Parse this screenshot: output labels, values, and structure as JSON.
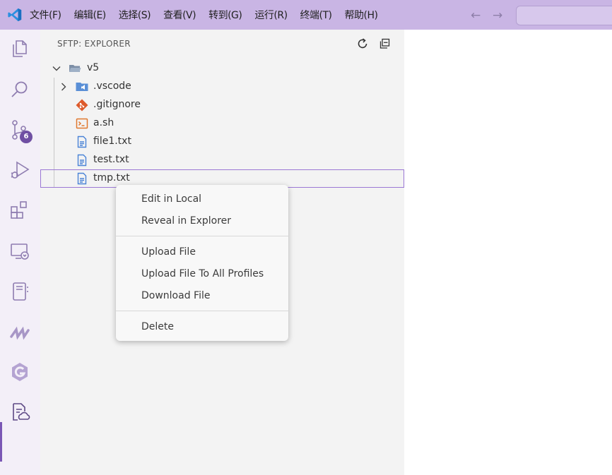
{
  "titlebar": {
    "menus": [
      "文件(F)",
      "编辑(E)",
      "选择(S)",
      "查看(V)",
      "转到(G)",
      "运行(R)",
      "终端(T)",
      "帮助(H)"
    ],
    "back_arrow": "←",
    "forward_arrow": "→"
  },
  "activity_bar": {
    "source_control_badge": "6"
  },
  "sidebar": {
    "title": "SFTP: EXPLORER",
    "root_folder": "v5",
    "items": [
      {
        "label": ".vscode",
        "icon": "vscode-folder-icon"
      },
      {
        "label": ".gitignore",
        "icon": "git-icon"
      },
      {
        "label": "a.sh",
        "icon": "shell-icon"
      },
      {
        "label": "file1.txt",
        "icon": "text-file-icon"
      },
      {
        "label": "test.txt",
        "icon": "text-file-icon"
      },
      {
        "label": "tmp.txt",
        "icon": "text-file-icon"
      }
    ]
  },
  "context_menu": {
    "groups": [
      [
        "Edit in Local",
        "Reveal in Explorer"
      ],
      [
        "Upload File",
        "Upload File To All Profiles",
        "Download File"
      ],
      [
        "Delete"
      ]
    ]
  },
  "colors": {
    "titlebar": "#c9b5e4",
    "accent": "#7a57b5",
    "sidebar_bg": "#f3f3f3"
  }
}
